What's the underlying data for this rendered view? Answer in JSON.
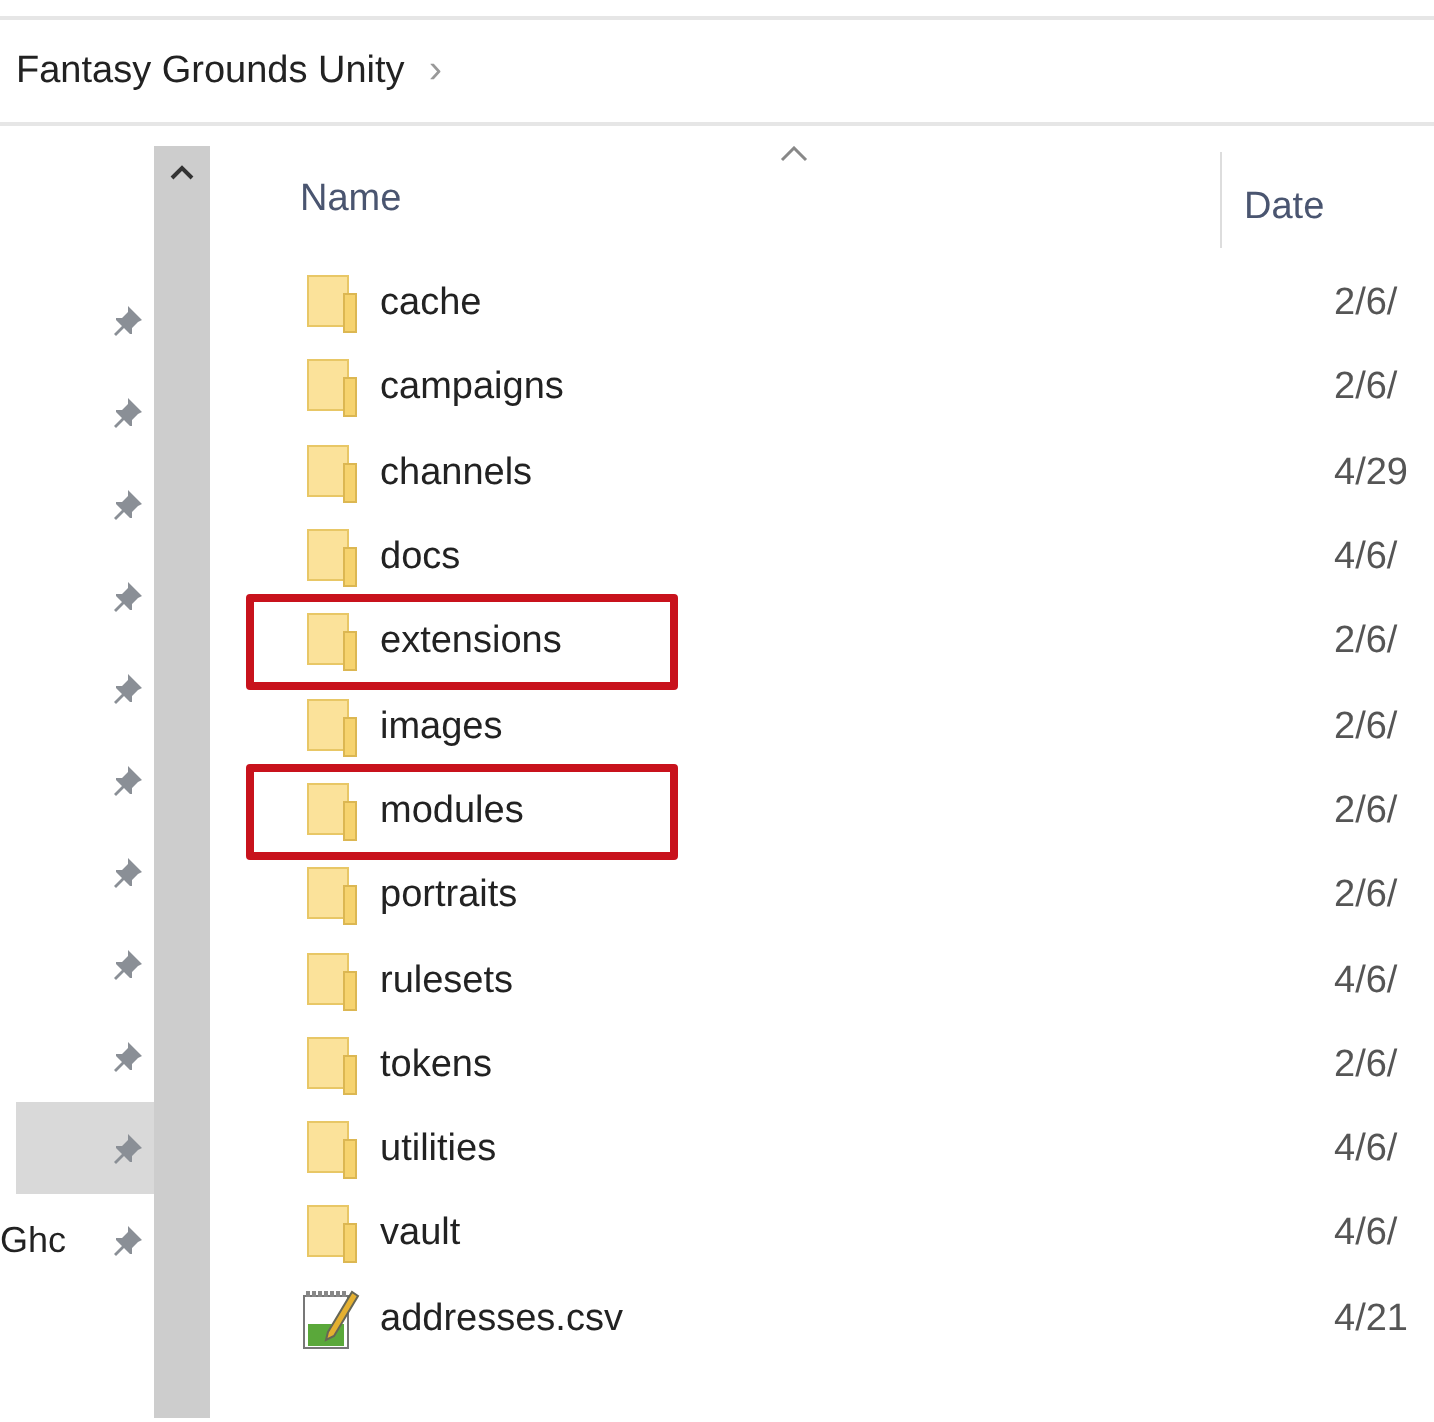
{
  "breadcrumb": {
    "label": "Fantasy Grounds Unity",
    "separator": "›"
  },
  "nav": {
    "items": [
      {
        "pinned": true,
        "selected": false
      },
      {
        "pinned": true,
        "selected": false
      },
      {
        "pinned": true,
        "selected": false
      },
      {
        "pinned": true,
        "selected": false
      },
      {
        "pinned": true,
        "selected": false
      },
      {
        "pinned": true,
        "selected": false
      },
      {
        "pinned": true,
        "selected": false
      },
      {
        "pinned": true,
        "selected": false
      },
      {
        "pinned": true,
        "selected": false
      },
      {
        "pinned": true,
        "selected": true
      },
      {
        "pinned": true,
        "selected": false,
        "label": "Ghc"
      }
    ]
  },
  "columns": [
    {
      "label": "Name",
      "sorted": true
    },
    {
      "label": "Date",
      "sorted": false
    }
  ],
  "rows": [
    {
      "kind": "folder",
      "name": "cache",
      "date": "2/6/",
      "highlighted": false
    },
    {
      "kind": "folder",
      "name": "campaigns",
      "date": "2/6/",
      "highlighted": false
    },
    {
      "kind": "folder",
      "name": "channels",
      "date": "4/29",
      "highlighted": false
    },
    {
      "kind": "folder",
      "name": "docs",
      "date": "4/6/",
      "highlighted": false
    },
    {
      "kind": "folder",
      "name": "extensions",
      "date": "2/6/",
      "highlighted": true
    },
    {
      "kind": "folder",
      "name": "images",
      "date": "2/6/",
      "highlighted": false
    },
    {
      "kind": "folder",
      "name": "modules",
      "date": "2/6/",
      "highlighted": true
    },
    {
      "kind": "folder",
      "name": "portraits",
      "date": "2/6/",
      "highlighted": false
    },
    {
      "kind": "folder",
      "name": "rulesets",
      "date": "4/6/",
      "highlighted": false
    },
    {
      "kind": "folder",
      "name": "tokens",
      "date": "2/6/",
      "highlighted": false
    },
    {
      "kind": "folder",
      "name": "utilities",
      "date": "4/6/",
      "highlighted": false
    },
    {
      "kind": "folder",
      "name": "vault",
      "date": "4/6/",
      "highlighted": false
    },
    {
      "kind": "file",
      "name": "addresses.csv",
      "date": "4/21",
      "highlighted": false
    }
  ]
}
